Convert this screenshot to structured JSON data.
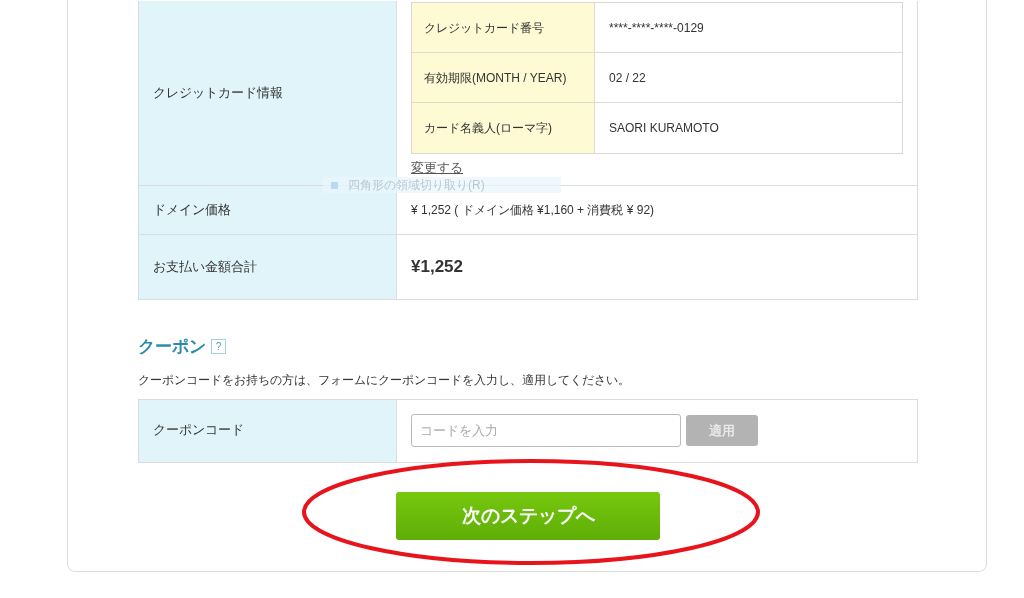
{
  "payment_table": {
    "card_info": {
      "label": "クレジットカード情報",
      "fields": [
        {
          "label": "クレジットカード番号",
          "value": "****-****-****-0129"
        },
        {
          "label": "有効期限(MONTH / YEAR)",
          "value": "02 / 22"
        },
        {
          "label": "カード名義人(ローマ字)",
          "value": "SAORI KURAMOTO"
        }
      ],
      "change_link": "変更する"
    },
    "rows": [
      {
        "kind": "normal",
        "label": "ドメイン価格",
        "value": "¥ 1,252 ( ドメイン価格 ¥1,160 + 消費税 ¥ 92)"
      },
      {
        "kind": "total",
        "label": "お支払い金額合計",
        "value": "¥1,252"
      }
    ]
  },
  "tooltip": {
    "text": "四角形の領域切り取り(R)"
  },
  "coupon": {
    "title": "クーポン",
    "help": "?",
    "description": "クーポンコードをお持ちの方は、フォームにクーポンコードを入力し、適用してください。",
    "label": "クーポンコード",
    "placeholder": "コードを入力",
    "apply_button": {
      "label": "適用",
      "disabled": true
    }
  },
  "next_button": "次のステップへ",
  "annotation": {
    "kind": "ellipse"
  }
}
